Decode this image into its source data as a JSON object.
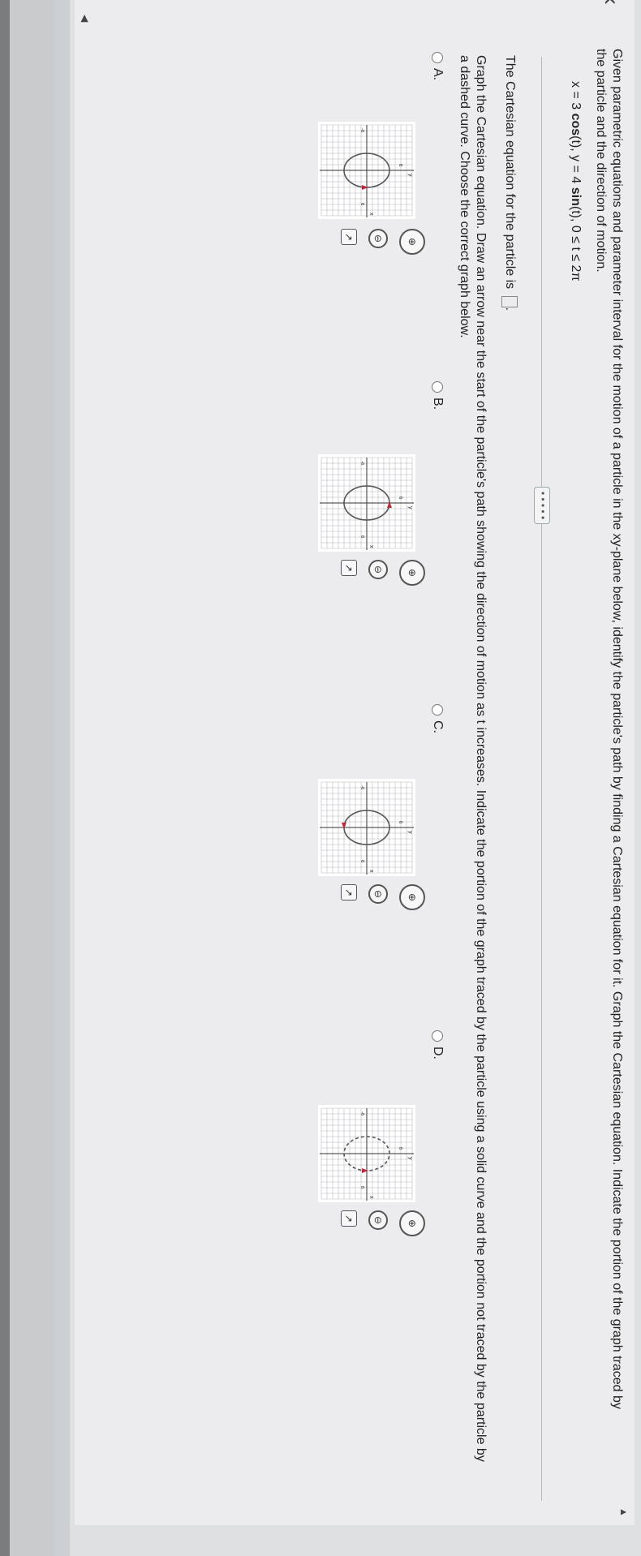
{
  "question": {
    "text": "Given parametric equations and parameter interval for the motion of a particle in the xy-plane below, identify the particle's path by finding a Cartesian equation for it. Graph the Cartesian equation. Indicate the portion of the graph traced by the particle and the direction of motion.",
    "equation_prefix": "x = 3",
    "equation_x_fn": "cos",
    "equation_mid": "(t), y = 4",
    "equation_y_fn": "sin",
    "equation_suffix": "(t), 0 ≤ t ≤ 2π"
  },
  "expand_button": "• • • • •",
  "prompt1_text": "The Cartesian equation for the particle is",
  "prompt1_end": ".",
  "prompt2_text": "Graph the Cartesian equation. Draw an arrow near the start of the particle's path showing the direction of motion as t increases. Indicate the portion of the graph traced by the particle using a solid curve and the portion not traced by the particle by a dashed curve. Choose the correct graph below.",
  "options": [
    {
      "label": "A.",
      "style": "solid",
      "arrow": "right"
    },
    {
      "label": "B.",
      "style": "solid",
      "arrow": "top"
    },
    {
      "label": "C.",
      "style": "solid",
      "arrow": "bottom"
    },
    {
      "label": "D.",
      "style": "dashed",
      "arrow": "right"
    }
  ],
  "axis_labels": {
    "x": "x",
    "y": "y",
    "tick_pos": "6",
    "tick_neg": "-6"
  },
  "icons": {
    "zoom_in": "zoom-in-icon",
    "zoom_out": "zoom-out-icon",
    "popout": "popout-icon",
    "back": "back-arrow-icon"
  },
  "colors": {
    "curve": "#555555",
    "arrow": "#c0283c",
    "grid": "#b8b8c0"
  }
}
